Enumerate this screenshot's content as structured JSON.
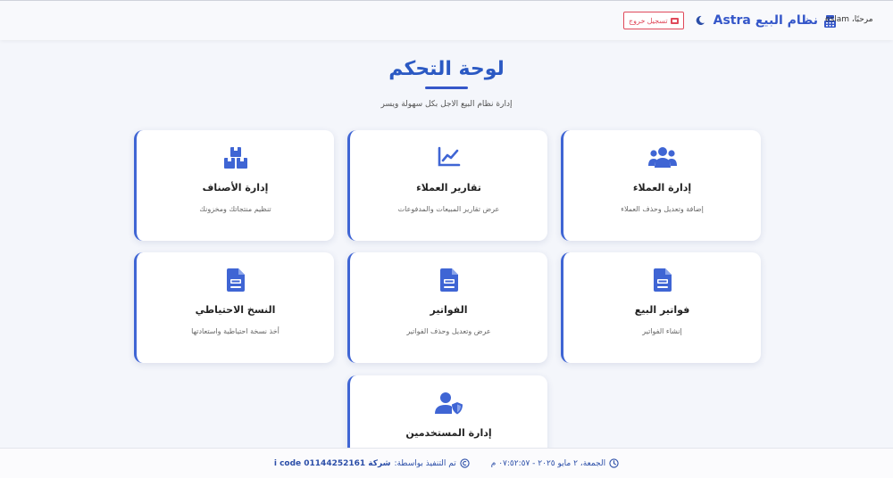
{
  "header": {
    "welcome": "مرحبًا، eslam",
    "brand_title": "نظام البيع Astra",
    "logout_label": "تسجيل خروج"
  },
  "page": {
    "title": "لوحة التحكم",
    "subtitle": "إدارة نظام البيع الاجل بكل سهولة ويسر"
  },
  "cards": [
    {
      "title": "إدارة العملاء",
      "desc": "إضافة وتعديل وحذف العملاء",
      "icon": "users-icon"
    },
    {
      "title": "تقارير العملاء",
      "desc": "عرض تقارير المبيعات والمدفوعات",
      "icon": "chart-line-icon"
    },
    {
      "title": "إدارة الأصناف",
      "desc": "تنظيم منتجاتك ومخزونك",
      "icon": "boxes-icon"
    },
    {
      "title": "فواتير البيع",
      "desc": "إنشاء الفواتير",
      "icon": "invoice-icon"
    },
    {
      "title": "الفواتير",
      "desc": "عرض وتعديل وحذف الفواتير",
      "icon": "invoice-icon"
    },
    {
      "title": "النسخ الاحتياطي",
      "desc": "أخذ نسخة احتياطية واستعادتها",
      "icon": "invoice-icon"
    },
    {
      "title": "إدارة المستخدمين",
      "desc": "",
      "icon": "user-shield-icon"
    }
  ],
  "footer": {
    "datetime": "الجمعة، ٢ مايو ٢٠٢٥ - ٠٧:٥٢:٥٧ م",
    "credit_label": "تم التنفيذ بواسطة:",
    "company": "شركة i code 01144252161"
  },
  "colors": {
    "accent": "#3557c9",
    "danger": "#e0495a",
    "background": "#f4f6fb"
  }
}
